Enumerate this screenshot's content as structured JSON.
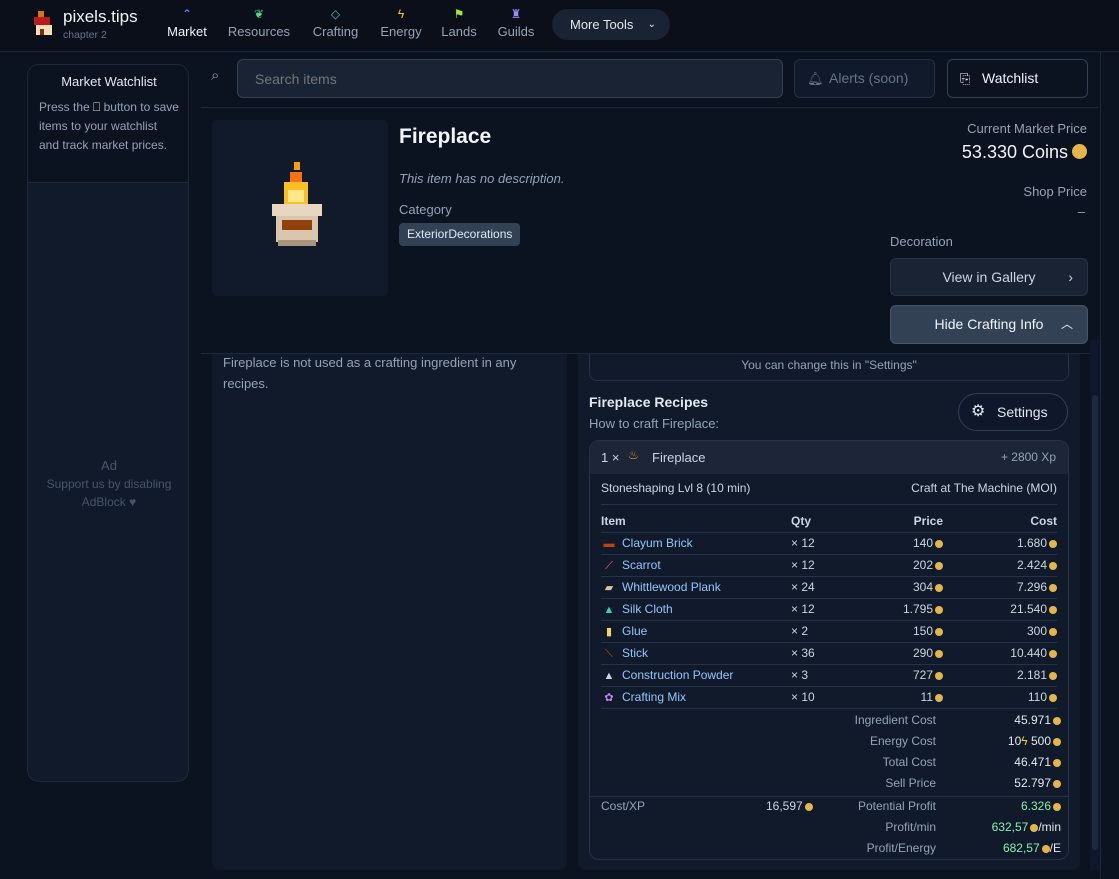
{
  "brand": {
    "name": "pixels.tips",
    "sub": "chapter 2"
  },
  "nav": [
    {
      "label": "Market",
      "icon": "chart-icon",
      "color": "#60a5fa",
      "glyph": "⌃"
    },
    {
      "label": "Resources",
      "icon": "sprout-icon",
      "color": "#4ade80",
      "glyph": "❦"
    },
    {
      "label": "Crafting",
      "icon": "gem-icon",
      "color": "#2dd4bf",
      "glyph": "◇"
    },
    {
      "label": "Energy",
      "icon": "bolt-icon",
      "color": "#facc15",
      "glyph": "ϟ"
    },
    {
      "label": "Lands",
      "icon": "flag-icon",
      "color": "#a3e635",
      "glyph": "⚑"
    },
    {
      "label": "Guilds",
      "icon": "castle-icon",
      "color": "#a78bfa",
      "glyph": "♜"
    }
  ],
  "more_tools": "More Tools",
  "watchlist": {
    "title": "Market Watchlist",
    "desc_pre": "Press the",
    "desc_post": "button to save items to your watchlist and track market prices.",
    "ad_title": "Ad",
    "ad_text": "Support us by disabling AdBlock ♥"
  },
  "search": {
    "placeholder": "Search items"
  },
  "alerts_label": "Alerts (soon)",
  "watchlist_button": "Watchlist",
  "item": {
    "name": "Fireplace",
    "description": "This item has no description.",
    "category_label": "Category",
    "category": "ExteriorDecorations",
    "cmp_label": "Current Market Price",
    "cmp_value": "53.330 Coins",
    "shop_label": "Shop Price",
    "shop_value": "–",
    "type_label": "Decoration",
    "gallery_button": "View in Gallery",
    "hide_button": "Hide Crafting Info"
  },
  "usage_text": "Fireplace is not used as a crafting ingredient in any recipes.",
  "settings_hint": "You can change this in \"Settings\"",
  "recipes": {
    "title": "Fireplace Recipes",
    "subtitle": "How to craft Fireplace:",
    "settings_button": "Settings",
    "head_qty": "1 ×",
    "head_name": "Fireplace",
    "head_xp": "+ 2800 Xp",
    "skill": "Stoneshaping Lvl 8 (10 min)",
    "craft_at": "Craft at The Machine (MOI)",
    "columns": [
      "Item",
      "Qty",
      "Price",
      "Cost"
    ],
    "rows": [
      {
        "item": "Clayum Brick",
        "qty": "× 12",
        "price": "140",
        "cost": "1.680",
        "icon": "brick-icon",
        "color": "#c2410c",
        "glyph": "▬"
      },
      {
        "item": "Scarrot",
        "qty": "× 12",
        "price": "202",
        "cost": "2.424",
        "icon": "carrot-icon",
        "color": "#f87171",
        "glyph": "⟋"
      },
      {
        "item": "Whittlewood Plank",
        "qty": "× 24",
        "price": "304",
        "cost": "7.296",
        "icon": "plank-icon",
        "color": "#d6c7a1",
        "glyph": "▰"
      },
      {
        "item": "Silk Cloth",
        "qty": "× 12",
        "price": "1.795",
        "cost": "21.540",
        "icon": "cloth-icon",
        "color": "#2dd4bf",
        "glyph": "▲"
      },
      {
        "item": "Glue",
        "qty": "× 2",
        "price": "150",
        "cost": "300",
        "icon": "glue-icon",
        "color": "#f5d36b",
        "glyph": "▮"
      },
      {
        "item": "Stick",
        "qty": "× 36",
        "price": "290",
        "cost": "10.440",
        "icon": "stick-icon",
        "color": "#b45309",
        "glyph": "⟍"
      },
      {
        "item": "Construction Powder",
        "qty": "× 3",
        "price": "727",
        "cost": "2.181",
        "icon": "powder-icon",
        "color": "#cbd5e1",
        "glyph": "▲"
      },
      {
        "item": "Crafting Mix",
        "qty": "× 10",
        "price": "11",
        "cost": "110",
        "icon": "mix-icon",
        "color": "#c084fc",
        "glyph": "✿"
      }
    ],
    "summary": {
      "ingredient_cost_label": "Ingredient Cost",
      "ingredient_cost": "45.971",
      "energy_cost_label": "Energy Cost",
      "energy_amount": "10",
      "energy_cost": "500",
      "total_cost_label": "Total Cost",
      "total_cost": "46.471",
      "sell_price_label": "Sell Price",
      "sell_price": "52.797",
      "cost_xp_label": "Cost/XP",
      "cost_xp": "16,597",
      "potential_profit_label": "Potential Profit",
      "potential_profit": "6.326",
      "profit_min_label": "Profit/min",
      "profit_min": "632,57",
      "profit_min_unit": "/min",
      "profit_energy_label": "Profit/Energy",
      "profit_energy": "682,57",
      "profit_energy_unit": "/E"
    }
  }
}
